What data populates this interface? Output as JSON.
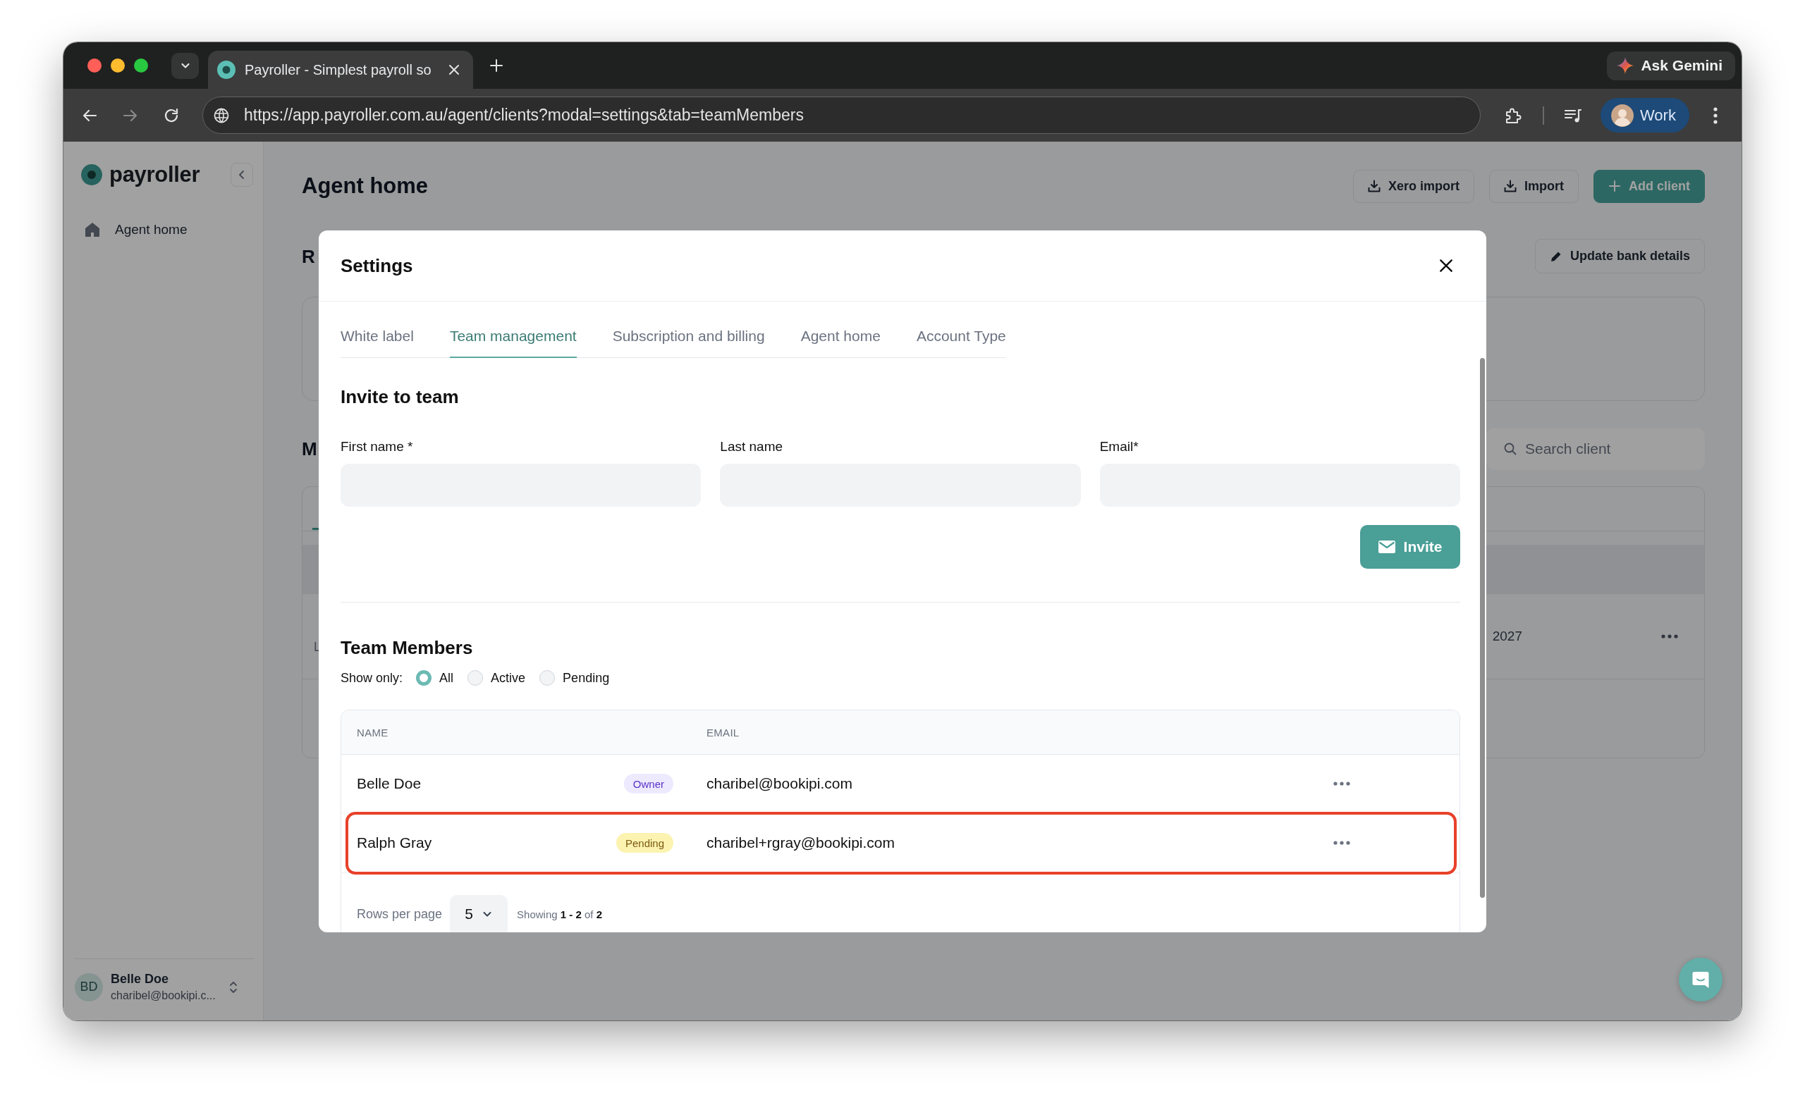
{
  "browser": {
    "tab": {
      "title": "Payroller - Simplest payroll so"
    },
    "url": "https://app.payroller.com.au/agent/clients?modal=settings&tab=teamMembers",
    "gemini": "Ask Gemini",
    "profile": "Work"
  },
  "sidebar": {
    "logo": "payroller",
    "items": [
      {
        "label": "Agent home"
      }
    ],
    "user": {
      "initials": "BD",
      "name": "Belle Doe",
      "email": "charibel@bookipi.c..."
    }
  },
  "page": {
    "title": "Agent home",
    "actions": [
      {
        "label": "Xero import",
        "kind": "download"
      },
      {
        "label": "Import",
        "kind": "download"
      },
      {
        "label": "Add client",
        "kind": "primary"
      }
    ],
    "bank_button": "Update bank details",
    "section_heading_1": "R",
    "section_heading_2": "M",
    "search": {
      "placeholder": "Search client"
    },
    "clients_table": {
      "rows": [
        {
          "column_1_subtext": "L",
          "column_2": "2027"
        }
      ]
    }
  },
  "settings": {
    "title": "Settings",
    "tabs": [
      {
        "label": "White label",
        "selected": false
      },
      {
        "label": "Team management",
        "selected": true
      },
      {
        "label": "Subscription and billing",
        "selected": false
      },
      {
        "label": "Agent home",
        "selected": false
      },
      {
        "label": "Account Type",
        "selected": false
      }
    ],
    "invite": {
      "heading": "Invite to team",
      "fields": [
        {
          "label": "First name *"
        },
        {
          "label": "Last name"
        },
        {
          "label": "Email*"
        }
      ],
      "button": "Invite"
    },
    "members": {
      "heading": "Team Members",
      "filter_label": "Show only:",
      "filters": [
        {
          "label": "All",
          "selected": true
        },
        {
          "label": "Active",
          "selected": false
        },
        {
          "label": "Pending",
          "selected": false
        }
      ],
      "columns": [
        "NAME",
        "EMAIL"
      ],
      "rows": [
        {
          "name": "Belle Doe",
          "badge": {
            "label": "Owner",
            "kind": "owner"
          },
          "email": "charibel@bookipi.com",
          "highlighted": false
        },
        {
          "name": "Ralph Gray",
          "badge": {
            "label": "Pending",
            "kind": "pending"
          },
          "email": "charibel+rgray@bookipi.com",
          "highlighted": true
        }
      ],
      "pagination": {
        "rows_per_page_label": "Rows per page",
        "rows_per_page": "5",
        "showing": "Showing **1 - 2** of **2**"
      }
    }
  }
}
